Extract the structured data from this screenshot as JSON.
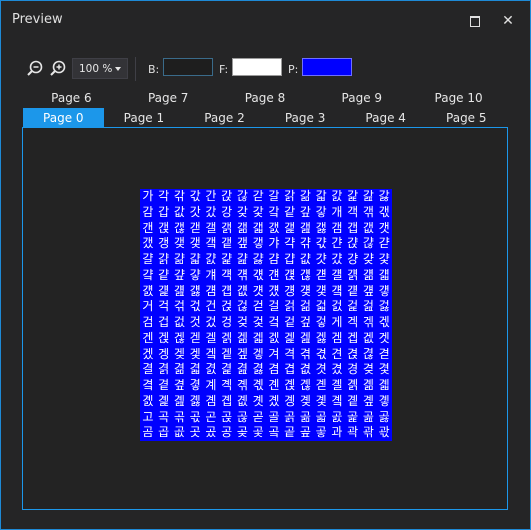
{
  "window": {
    "title": "Preview"
  },
  "toolbar": {
    "zoom_value": "100 %",
    "background_label": "B:",
    "foreground_label": "F:",
    "paper_label": "P:",
    "background_color": "#1e1e1e",
    "foreground_color": "#ffffff",
    "paper_color": "#0000ff"
  },
  "tabs_row_top": [
    "Page 6",
    "Page 7",
    "Page 8",
    "Page 9",
    "Page 10"
  ],
  "tabs_row_bottom": [
    "Page 0",
    "Page 1",
    "Page 2",
    "Page 3",
    "Page 4",
    "Page 5"
  ],
  "active_tab": "Page 0",
  "glyph_rows": [
    "가각갂갃간갅갆갇갈갉갊갋갌갍갎갏",
    "감갑값갓갔강갖갗갘같갚갛개객갞갟",
    "갠갡갢갣갤갥갦갧갨갩갪갫갬갭갮갯",
    "갰갱갲갳갴갵갶갷갸갹갺갻갼갽갾갿",
    "걀걁걂걃걄걅걆걇걈걉걊걋걌걍걎걏",
    "걐걑걒걓걔걕걖걗걘걙걚걛걜걝걞걟",
    "걠걡걢걣걤걥걦걧걨걩걪걫걬걭걮걯",
    "거걱걲걳건걵걶걷걸걹걺걻걼걽걾걿",
    "검겁겂것겄겅겆겇겈겉겊겋게겍겎겏",
    "겐겑겒겓겔겕겖겗겘겙겚겛겜겝겞겟",
    "겠겡겢겣겤겥겦겧겨격겪겫견겭겮겯",
    "결겱겲겳겴겵겶겷겸겹겺겻겼경겾겿",
    "곀곁곂곃계곅곆곇곈곉곊곋곌곍곎곏",
    "곐곑곒곓곔곕곖곗곘곙곚곛곜곝곞곟",
    "고곡곢곣곤곥곦곧골곩곪곫곬곭곮곯",
    "곰곱곲곳곴공곶곷곸곹곺곻과곽곾곿"
  ]
}
